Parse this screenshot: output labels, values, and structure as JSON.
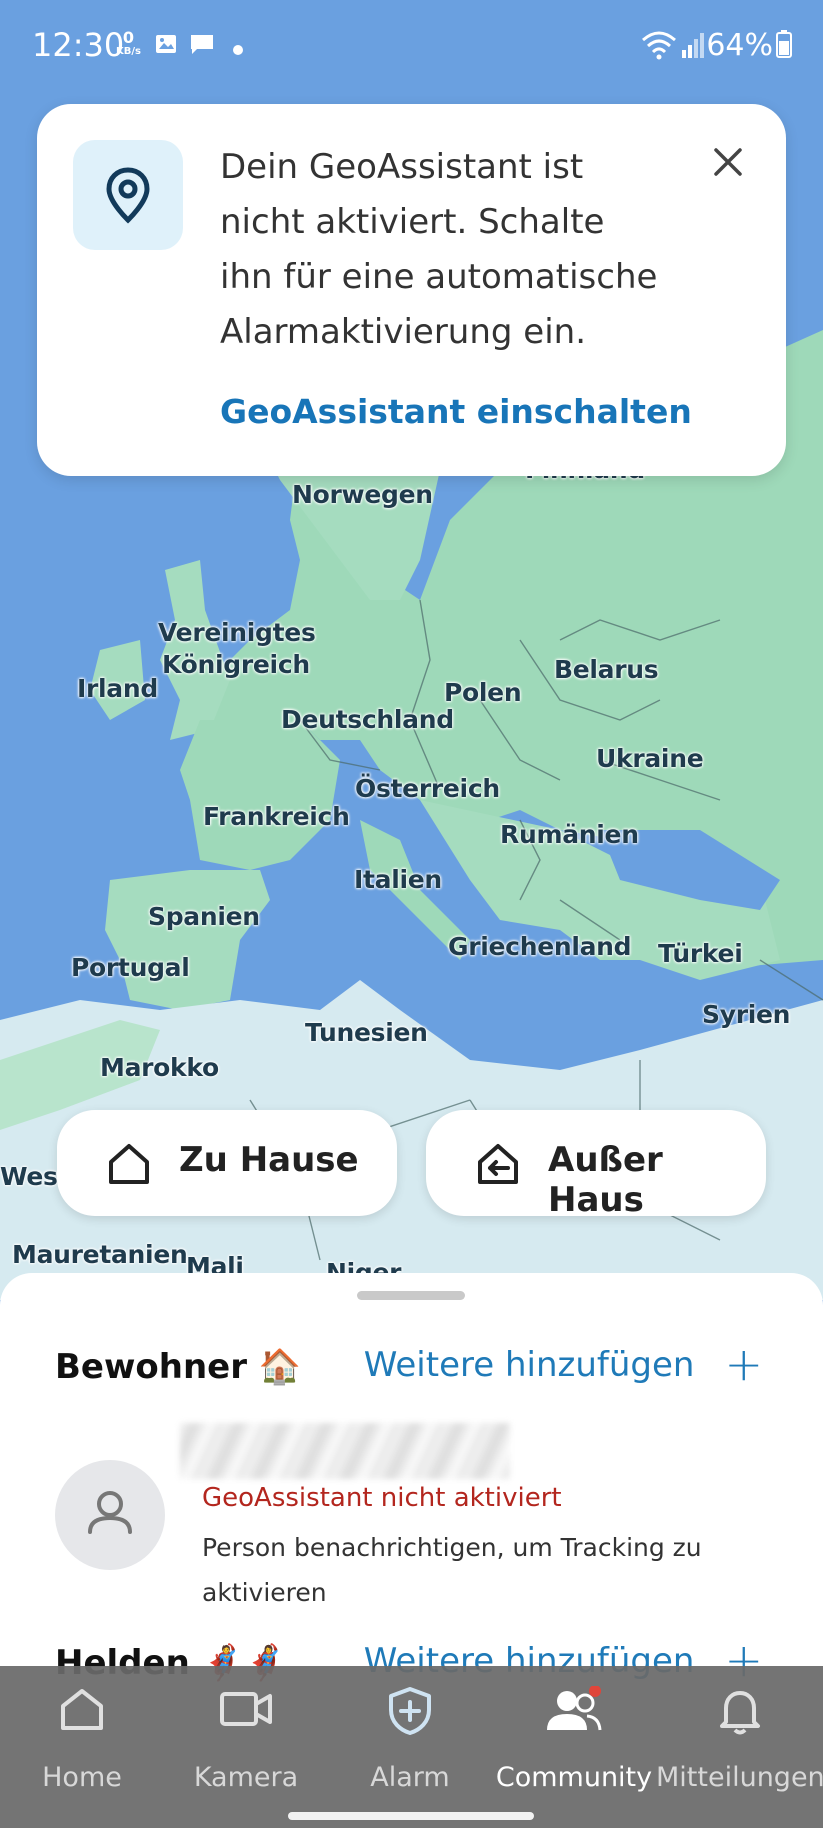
{
  "status_bar": {
    "time": "12:30",
    "kbs_value": "0",
    "kbs_unit": "KB/s",
    "battery": "64%"
  },
  "map": {
    "labels": {
      "finland": "Finnland",
      "norway": "Norwegen",
      "uk_line1": "Vereinigtes",
      "uk_line2": "Königreich",
      "ireland": "Irland",
      "belarus": "Belarus",
      "poland": "Polen",
      "germany": "Deutschland",
      "ukraine": "Ukraine",
      "austria": "Österreich",
      "france": "Frankreich",
      "romania": "Rumänien",
      "italy": "Italien",
      "spain": "Spanien",
      "portugal": "Portugal",
      "greece": "Griechenland",
      "turkey": "Türkei",
      "syria": "Syrien",
      "tunisia": "Tunesien",
      "morocco": "Marokko",
      "west": "West",
      "mauritania": "Mauretanien",
      "mali": "Mali",
      "niger": "Niger"
    }
  },
  "geo_card": {
    "message": "Dein GeoAssistant ist nicht aktiviert. Schalte ihn für eine automatische Alarmaktivierung ein.",
    "action": "GeoAssistant einschalten"
  },
  "mode_buttons": {
    "home": "Zu Hause",
    "away": "Außer Haus"
  },
  "residents": {
    "title": "Bewohner 🏠",
    "add": "Weitere hinzufügen",
    "member_status": "GeoAssistant nicht aktiviert",
    "member_hint": "Person benachrichtigen, um Tracking zu aktivieren"
  },
  "heroes": {
    "title": "Helden 🦸🦸‍♀️",
    "add": "Weitere hinzufügen"
  },
  "nav": {
    "home": "Home",
    "camera": "Kamera",
    "alarm": "Alarm",
    "community": "Community",
    "notifications": "Mitteilungen",
    "active": "community"
  },
  "colors": {
    "accent": "#1875b8",
    "warning": "#b3261e",
    "sea": "#6aa0e0",
    "land": "#9ed9b9"
  }
}
